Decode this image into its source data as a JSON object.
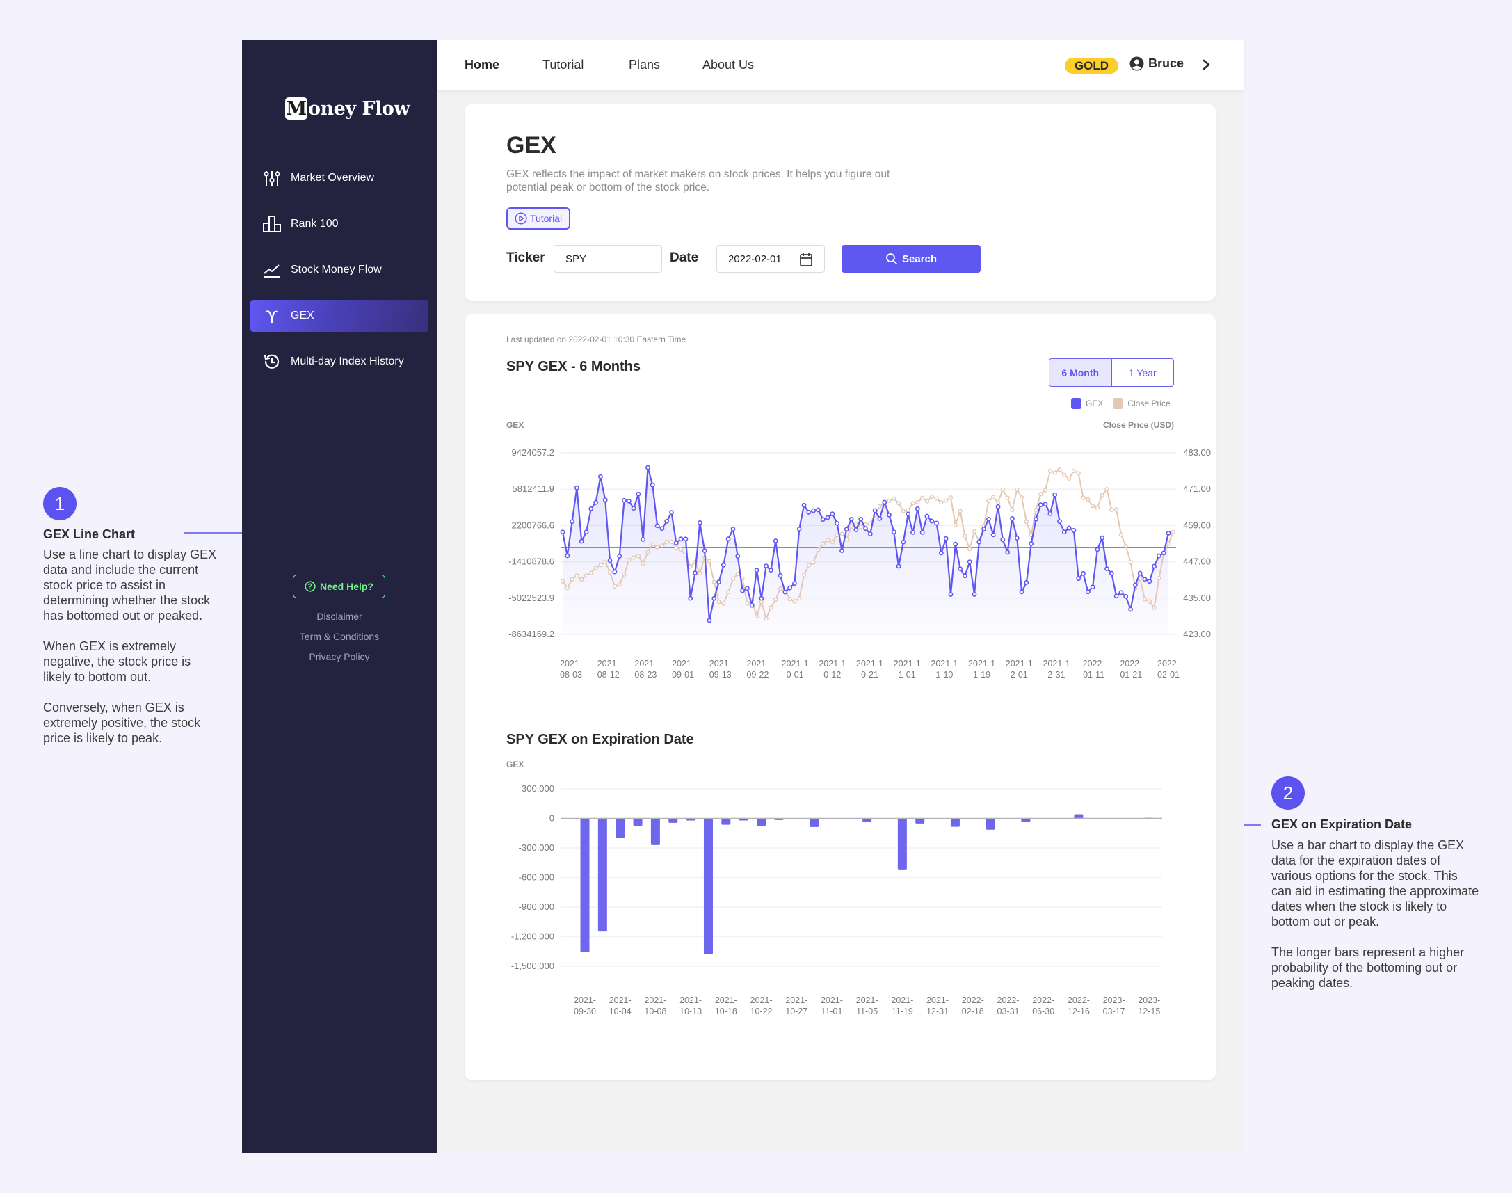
{
  "brand": {
    "logo_initial": "M",
    "logo_rest": "oney Flow"
  },
  "sidebar": {
    "items": [
      {
        "label": "Market Overview",
        "icon": "sliders-icon",
        "active": false
      },
      {
        "label": "Rank 100",
        "icon": "bar-rank-icon",
        "active": false
      },
      {
        "label": "Stock Money Flow",
        "icon": "trend-line-icon",
        "active": false
      },
      {
        "label": "GEX",
        "icon": "gamma-icon",
        "active": true
      },
      {
        "label": "Multi-day Index History",
        "icon": "history-icon",
        "active": false
      }
    ],
    "help_label": "Need Help?",
    "footer_links": [
      "Disclaimer",
      "Term & Conditions",
      "Privacy Policy"
    ]
  },
  "topbar": {
    "links": [
      "Home",
      "Tutorial",
      "Plans",
      "About Us"
    ],
    "active_link": "Home",
    "badge": "GOLD",
    "user_name": "Bruce"
  },
  "colors": {
    "accent": "#5f57f2",
    "sidebar_bg": "#23233f",
    "gex_line": "#5f57f2",
    "price_line": "#e3c9b5",
    "gold": "#fdcd29",
    "help_green": "#6ef28a"
  },
  "gex_card": {
    "title": "GEX",
    "description": "GEX reflects the impact of market makers on stock prices. It helps you figure out potential peak or bottom of the stock price.",
    "tutorial_label": "Tutorial",
    "ticker_label": "Ticker",
    "ticker_value": "SPY",
    "date_label": "Date",
    "date_value": "2022-02-01",
    "search_label": "Search"
  },
  "chart_card": {
    "last_updated": "Last updated on 2022-02-01 10:30 Eastern Time",
    "range_options": [
      "6 Month",
      "1 Year"
    ],
    "selected_range": "6 Month"
  },
  "annotations": [
    {
      "number": "1",
      "title": "GEX Line Chart",
      "text": "Use a line chart to display GEX data and include the current stock price to assist in determining whether the stock has bottomed out or peaked.\n\nWhen GEX is extremely negative, the stock price is likely to bottom out.\n\nConversely, when GEX is extremely positive, the stock price is likely to peak."
    },
    {
      "number": "2",
      "title": "GEX on Expiration Date",
      "text": "Use a bar chart to display the GEX data for the expiration dates of various options for the stock. This can aid in estimating the approximate dates when the stock is likely to bottom out or peak.\n\nThe longer bars represent a higher probability of the bottoming out or peaking dates."
    }
  ],
  "chart_data": [
    {
      "type": "line",
      "title": "SPY GEX - 6 Months",
      "ylabel": "GEX",
      "y2label": "Close Price (USD)",
      "legend": [
        "GEX",
        "Close Price"
      ],
      "legend_position": "top-right",
      "grid": true,
      "ylim": [
        -8634169.2,
        9424057.2
      ],
      "y_ticks": [
        "9424057.2",
        "5812411.9",
        "2200766.6",
        "-1410878.6",
        "-5022523.9",
        "-8634169.2"
      ],
      "y2lim": [
        423,
        483
      ],
      "y2_ticks": [
        "483.00",
        "471.00",
        "459.00",
        "447.00",
        "435.00",
        "423.00"
      ],
      "reference_line_gex": 0,
      "x_ticks": [
        [
          "2021-",
          "08-03"
        ],
        [
          "2021-",
          "08-12"
        ],
        [
          "2021-",
          "08-23"
        ],
        [
          "2021-",
          "09-01"
        ],
        [
          "2021-",
          "09-13"
        ],
        [
          "2021-",
          "09-22"
        ],
        [
          "2021-1",
          "0-01"
        ],
        [
          "2021-1",
          "0-12"
        ],
        [
          "2021-1",
          "0-21"
        ],
        [
          "2021-1",
          "1-01"
        ],
        [
          "2021-1",
          "1-10"
        ],
        [
          "2021-1",
          "1-19"
        ],
        [
          "2021-1",
          "2-01"
        ],
        [
          "2021-1",
          "2-31"
        ],
        [
          "2022-",
          "01-11"
        ],
        [
          "2022-",
          "01-21"
        ],
        [
          "2022-",
          "02-01"
        ]
      ],
      "series": [
        {
          "name": "GEX",
          "values": [
            1552377,
            -809127,
            2594217,
            5951257,
            626297,
            1552377,
            3867577,
            4492681,
            7062553,
            4747353,
            -1295319,
            -2406615,
            -855431,
            4701049,
            4631593,
            3913881,
            5326153,
            811513,
            7965481,
            6229081,
            2177481,
            1899657,
            2617369,
            3497145,
            464233,
            857817,
            857817,
            -5045943,
            -2522375,
            2478457,
            -299783,
            -7245383,
            -5045943,
            -3425303,
            -1735207,
            857817,
            1853353,
            -855431,
            -4281927,
            -4050407,
            -5740503,
            -2244551,
            -5045943,
            -1827815,
            -2244551,
            672601,
            -2777047,
            -4420839,
            -4004103,
            -3564215,
            1853353,
            4214857,
            3520297,
            3682361,
            3751817,
            2802585,
            2987801,
            3358233,
            2409001,
            -299783,
            1830201,
            2825737,
            1783897,
            2825737,
            1899657,
            1367161,
            3682361,
            2895193,
            4515833,
            3242473,
            1552377,
            -1850967,
            556841,
            3335081,
            1506073,
            3867577,
            1506073,
            3126713,
            2640521,
            2432153,
            -531303,
            904121,
            -4652359,
            348473,
            -2105639,
            -2800199,
            -1411079,
            -4652359,
            556841,
            1853353,
            2825737,
            1274553,
            4075945,
            788361,
            -461847,
            2895193,
            950425,
            -4397687,
            -3471607,
            394777,
            2825737,
            4261161,
            4330617,
            3381385,
            5256697,
            2594217,
            1552377,
            1945961,
            1714441,
            -3078023,
            -2568679,
            -4397687,
            -3911495,
            -184023,
            973577,
            -2105639,
            -2545527,
            -4814423,
            -4467143,
            -4860727,
            -6134087,
            -3703127,
            -2545527,
            -3147479,
            -3355847,
            -1850967,
            -809127,
            -531303,
            1436617
          ]
        },
        {
          "name": "Close Price",
          "values": [
            440.54,
            438.39,
            441.23,
            442.46,
            441.15,
            442.46,
            443.31,
            444.92,
            445.92,
            447.0,
            443.54,
            438.92,
            439.62,
            442.85,
            447.62,
            448.38,
            449.0,
            446.46,
            450.23,
            452.85,
            451.85,
            452.31,
            453.62,
            453.62,
            451.69,
            451.08,
            449.15,
            445.38,
            446.92,
            443.15,
            448.38,
            447.23,
            440.31,
            433.77,
            433.15,
            437.0,
            441.46,
            443.0,
            441.46,
            433.15,
            434.31,
            429.0,
            433.77,
            428.23,
            431.85,
            434.54,
            438.15,
            437.62,
            434.69,
            433.92,
            434.92,
            442.62,
            445.85,
            446.77,
            451.0,
            453.0,
            454.15,
            453.54,
            455.85,
            456.23,
            454.38,
            458.62,
            459.31,
            458.54,
            459.31,
            459.69,
            462.46,
            465.31,
            466.46,
            467.15,
            467.92,
            466.38,
            463.77,
            464.0,
            466.38,
            466.69,
            468.15,
            467.0,
            468.54,
            467.92,
            466.62,
            467.23,
            468.23,
            459.15,
            463.77,
            455.54,
            451.23,
            457.0,
            453.77,
            458.77,
            467.08,
            468.38,
            466.62,
            470.85,
            468.15,
            464.15,
            470.85,
            468.23,
            460.23,
            455.85,
            464.15,
            469.38,
            470.69,
            477.0,
            476.46,
            477.46,
            475.69,
            474.54,
            477.0,
            476.23,
            468.15,
            467.62,
            465.46,
            464.92,
            469.0,
            471.0,
            464.15,
            464.31,
            456.0,
            452.23,
            446.85,
            438.23,
            441.46,
            434.54,
            433.92,
            431.77,
            441.62,
            449.69,
            452.92,
            456.85
          ]
        }
      ]
    },
    {
      "type": "bar",
      "title": "SPY GEX on Expiration Date",
      "ylabel": "GEX",
      "ylim": [
        -1500000,
        300000
      ],
      "y_ticks": [
        "300,000",
        "0",
        "-300,000",
        "-600,000",
        "-900,000",
        "-1,200,000",
        "-1,500,000"
      ],
      "grid": true,
      "bars": [
        {
          "label": "2021-09-30",
          "value": -1355000
        },
        {
          "label": "",
          "value": -1148000
        },
        {
          "label": "2021-10-04",
          "value": -195000
        },
        {
          "label": "",
          "value": -74000
        },
        {
          "label": "2021-10-08",
          "value": -271000
        },
        {
          "label": "",
          "value": -45000
        },
        {
          "label": "2021-10-13",
          "value": -21000
        },
        {
          "label": "",
          "value": -1380000
        },
        {
          "label": "2021-10-18",
          "value": -64000
        },
        {
          "label": "",
          "value": -21000
        },
        {
          "label": "2021-10-22",
          "value": -75000
        },
        {
          "label": "",
          "value": -17000
        },
        {
          "label": "2021-10-27",
          "value": -6000
        },
        {
          "label": "",
          "value": -87000
        },
        {
          "label": "2021-11-01",
          "value": -5000
        },
        {
          "label": "",
          "value": -4000
        },
        {
          "label": "2021-11-05",
          "value": -35000
        },
        {
          "label": "",
          "value": -5000
        },
        {
          "label": "2021-11-19",
          "value": -518000
        },
        {
          "label": "",
          "value": -52000
        },
        {
          "label": "2021-12-31",
          "value": -4000
        },
        {
          "label": "",
          "value": -86000
        },
        {
          "label": "2022-02-18",
          "value": -3000
        },
        {
          "label": "",
          "value": -115000
        },
        {
          "label": "2022-03-31",
          "value": -10000
        },
        {
          "label": "",
          "value": -34000
        },
        {
          "label": "2022-06-30",
          "value": -4000
        },
        {
          "label": "",
          "value": -10000
        },
        {
          "label": "2022-12-16",
          "value": 42000
        },
        {
          "label": "",
          "value": -2000
        },
        {
          "label": "2023-03-17",
          "value": -2000
        },
        {
          "label": "",
          "value": -2000
        },
        {
          "label": "2023-12-15",
          "value": 6000
        }
      ]
    }
  ]
}
